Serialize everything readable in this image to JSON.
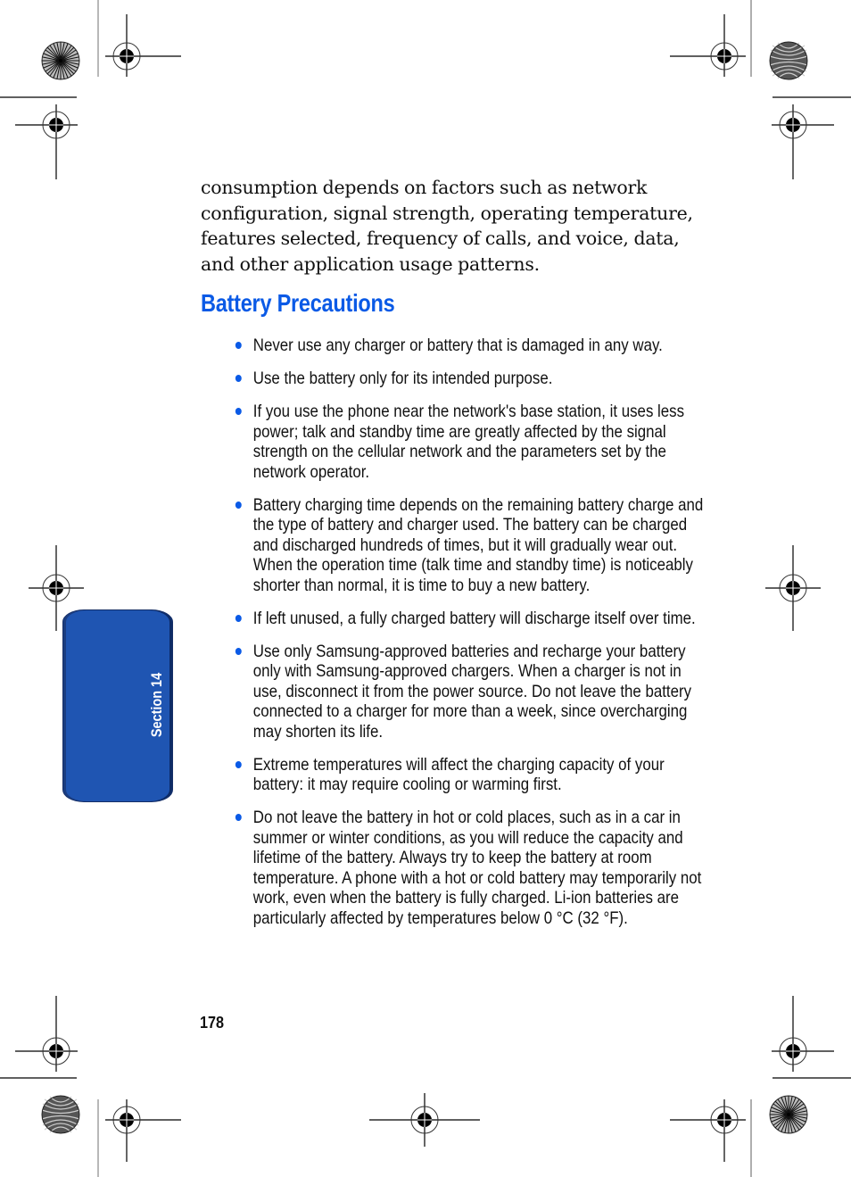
{
  "document": {
    "intro_paragraph": "consumption depends on factors such as network configuration, signal strength, operating temperature, features selected, frequency of calls, and voice, data, and other application usage patterns.",
    "heading": "Battery Precautions",
    "bullets": [
      "Never use any charger or battery that is damaged in any way.",
      "Use the battery only for its intended purpose.",
      "If you use the phone near the network's base station, it uses less power; talk and standby time are greatly affected by the signal strength on the cellular network and the parameters set by the network operator.",
      "Battery charging time depends on the remaining battery charge and the type of battery and charger used. The battery can be charged and discharged hundreds of times, but it will gradually wear out. When the operation time (talk time and standby time) is noticeably shorter than normal, it is time to buy a new battery.",
      "If left unused, a fully charged battery will discharge itself over time.",
      "Use only Samsung-approved batteries and recharge your battery only with Samsung-approved chargers. When a charger is not in use, disconnect it from the power source. Do not leave the battery connected to a charger for more than a week, since overcharging may shorten its life.",
      "Extreme temperatures will affect the charging capacity of your battery: it may require cooling or warming first.",
      "Do not leave the battery in hot or cold places, such as in a car in summer or winter conditions, as you will reduce the capacity and lifetime of the battery. Always try to keep the battery at room temperature. A phone with a hot or cold battery may temporarily not work, even when the battery is fully charged. Li-ion batteries are particularly affected by temperatures below 0 °C (32 °F)."
    ],
    "page_number": "178",
    "section_tab": "Section 14"
  },
  "colors": {
    "accent_blue": "#0a5ae6",
    "tab_blue": "#1f55b2"
  },
  "icons": {
    "registration_mark": "crosshair-target-icon",
    "color_bar_radial": "starburst-target-icon",
    "color_bar_moire": "moire-target-icon"
  }
}
